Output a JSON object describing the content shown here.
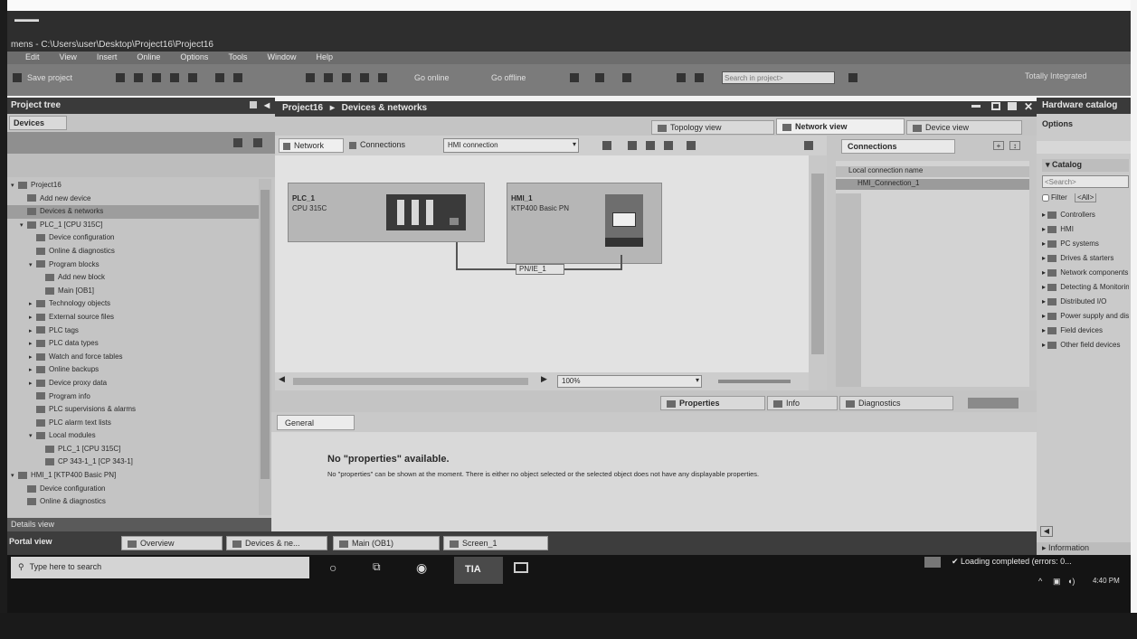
{
  "window": {
    "title": "mens - C:\\Users\\user\\Desktop\\Project16\\Project16"
  },
  "menu": [
    "Edit",
    "View",
    "Insert",
    "Online",
    "Options",
    "Tools",
    "Window",
    "Help"
  ],
  "toolbar": {
    "save_label": "Save project",
    "go_online": "Go online",
    "go_offline": "Go offline",
    "search_placeholder": "Search in project>",
    "right_text": "Totally Integrated"
  },
  "project_tree": {
    "title": "Project tree",
    "tab": "Devices",
    "items": [
      {
        "label": "Project16",
        "indent": 0,
        "expander": "▾"
      },
      {
        "label": "Add new device",
        "indent": 1,
        "expander": ""
      },
      {
        "label": "Devices & networks",
        "indent": 1,
        "expander": ""
      },
      {
        "label": "PLC_1 [CPU 315C]",
        "indent": 1,
        "expander": "▾"
      },
      {
        "label": "Device configuration",
        "indent": 2,
        "expander": ""
      },
      {
        "label": "Online & diagnostics",
        "indent": 2,
        "expander": ""
      },
      {
        "label": "Program blocks",
        "indent": 2,
        "expander": "▾"
      },
      {
        "label": "Add new block",
        "indent": 3,
        "expander": ""
      },
      {
        "label": "Main [OB1]",
        "indent": 3,
        "expander": ""
      },
      {
        "label": "Technology objects",
        "indent": 2,
        "expander": "▸"
      },
      {
        "label": "External source files",
        "indent": 2,
        "expander": "▸"
      },
      {
        "label": "PLC tags",
        "indent": 2,
        "expander": "▸"
      },
      {
        "label": "PLC data types",
        "indent": 2,
        "expander": "▸"
      },
      {
        "label": "Watch and force tables",
        "indent": 2,
        "expander": "▸"
      },
      {
        "label": "Online backups",
        "indent": 2,
        "expander": "▸"
      },
      {
        "label": "Device proxy data",
        "indent": 2,
        "expander": "▸"
      },
      {
        "label": "Program info",
        "indent": 2,
        "expander": ""
      },
      {
        "label": "PLC supervisions & alarms",
        "indent": 2,
        "expander": ""
      },
      {
        "label": "PLC alarm text lists",
        "indent": 2,
        "expander": ""
      },
      {
        "label": "Local modules",
        "indent": 2,
        "expander": "▾"
      },
      {
        "label": "PLC_1 [CPU 315C]",
        "indent": 3,
        "expander": ""
      },
      {
        "label": "CP 343-1_1 [CP 343-1]",
        "indent": 3,
        "expander": ""
      },
      {
        "label": "HMI_1 [KTP400 Basic PN]",
        "indent": 0,
        "expander": "▾"
      },
      {
        "label": "Device configuration",
        "indent": 1,
        "expander": ""
      },
      {
        "label": "Online & diagnostics",
        "indent": 1,
        "expander": ""
      }
    ],
    "details_view": "Details view"
  },
  "editor": {
    "breadcrumb_project": "Project16",
    "breadcrumb_sep": "▸",
    "breadcrumb_page": "Devices & networks",
    "view_tabs": [
      "Topology view",
      "Network view",
      "Device view"
    ],
    "network_btn": "Network",
    "connections_btn": "Connections",
    "connection_type": "HMI connection",
    "devices": [
      {
        "name": "PLC_1",
        "type": "CPU 315C"
      },
      {
        "name": "HMI_1",
        "type": "KTP400 Basic PN"
      }
    ],
    "subnet_label": "PN/IE_1",
    "zoom": "100%"
  },
  "connections_panel": {
    "tab": "Connections",
    "header": "Local connection name",
    "row": "HMI_Connection_1"
  },
  "inspector": {
    "tabs": [
      "Properties",
      "Info",
      "Diagnostics"
    ],
    "general_tab": "General",
    "heading": "No \"properties\" available.",
    "body": "No \"properties\" can be shown at the moment. There is either no object selected or the selected object does not have any displayable properties."
  },
  "portal_tabs": [
    "Overview",
    "Devices & ne...",
    "Main (OB1)",
    "Screen_1"
  ],
  "portal_view": "Portal view",
  "right_pane": {
    "title": "Hardware catalog",
    "options": "Options",
    "catalog": "Catalog",
    "search": "<Search>",
    "filter": "Filter",
    "profile": "<All>",
    "items": [
      "Controllers",
      "HMI",
      "PC systems",
      "Drives & starters",
      "Network components",
      "Detecting & Monitoring",
      "Distributed I/O",
      "Power supply and distribution",
      "Field devices",
      "Other field devices"
    ],
    "information": "Information"
  },
  "status": {
    "text": "Loading completed (errors: 0..."
  },
  "taskbar": {
    "search_placeholder": "Type here to search",
    "time": "4:40 PM",
    "tia_label": "TIA"
  }
}
